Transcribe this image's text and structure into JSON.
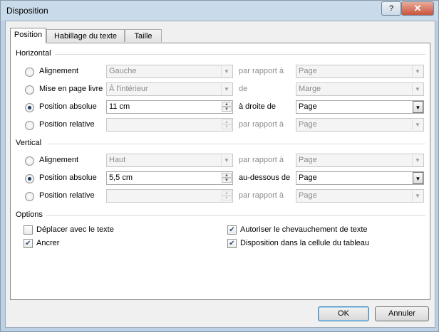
{
  "window": {
    "title": "Disposition",
    "help_label": "?",
    "close_label": "✕"
  },
  "tabs": [
    "Position",
    "Habillage du texte",
    "Taille"
  ],
  "horizontal": {
    "title": "Horizontal",
    "rows": [
      {
        "label": "Alignement",
        "value": "Gauche",
        "relation": "par rapport à",
        "target": "Page",
        "selected": false,
        "enabled": false
      },
      {
        "label": "Mise en page livre",
        "value": "À l'intérieur",
        "relation": "de",
        "target": "Marge",
        "selected": false,
        "enabled": false
      },
      {
        "label": "Position absolue",
        "value": "11 cm",
        "relation": "à droite de",
        "target": "Page",
        "selected": true,
        "enabled": true
      },
      {
        "label": "Position relative",
        "value": "",
        "relation": "par rapport à",
        "target": "Page",
        "selected": false,
        "enabled": false
      }
    ]
  },
  "vertical": {
    "title": "Vertical",
    "rows": [
      {
        "label": "Alignement",
        "value": "Haut",
        "relation": "par rapport à",
        "target": "Page",
        "selected": false,
        "enabled": false
      },
      {
        "label": "Position absolue",
        "value": "5,5 cm",
        "relation": "au-dessous de",
        "target": "Page",
        "selected": true,
        "enabled": true
      },
      {
        "label": "Position relative",
        "value": "",
        "relation": "par rapport à",
        "target": "Page",
        "selected": false,
        "enabled": false
      }
    ]
  },
  "options": {
    "title": "Options",
    "move_with_text": {
      "label": "Déplacer avec le texte",
      "checked": false
    },
    "lock_anchor": {
      "label": "Ancrer",
      "checked": true
    },
    "allow_overlap": {
      "label": "Autoriser le chevauchement de texte",
      "checked": true
    },
    "layout_in_cell": {
      "label": "Disposition dans la cellule du tableau",
      "checked": true
    }
  },
  "buttons": {
    "ok": "OK",
    "cancel": "Annuler"
  },
  "icons": {
    "dropdown": "▼",
    "spin_up": "▲",
    "spin_down": "▼",
    "check": "✔"
  }
}
